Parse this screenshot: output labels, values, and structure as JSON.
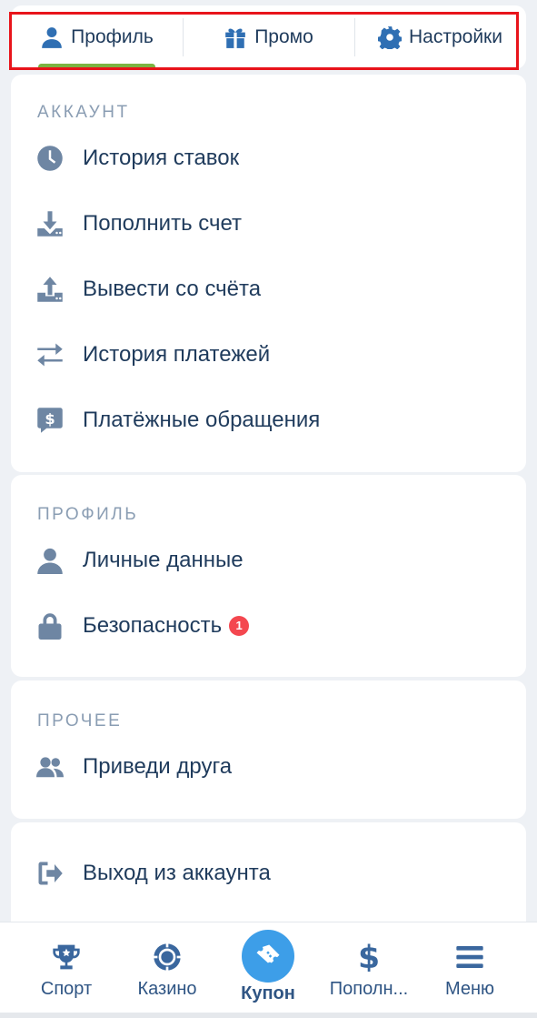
{
  "tabs": [
    {
      "label": "Профиль",
      "icon": "user-icon",
      "active": true
    },
    {
      "label": "Промо",
      "icon": "gift-icon",
      "active": false
    },
    {
      "label": "Настройки",
      "icon": "gear-icon",
      "active": false
    }
  ],
  "account": {
    "title": "АККАУНТ",
    "items": [
      {
        "label": "История ставок",
        "icon": "clock-icon"
      },
      {
        "label": "Пополнить счет",
        "icon": "download-icon"
      },
      {
        "label": "Вывести со счёта",
        "icon": "upload-icon"
      },
      {
        "label": "История платежей",
        "icon": "transfer-arrows-icon"
      },
      {
        "label": "Платёжные обращения",
        "icon": "dollar-chat-icon"
      }
    ]
  },
  "profile": {
    "title": "ПРОФИЛЬ",
    "items": [
      {
        "label": "Личные данные",
        "icon": "user-icon"
      },
      {
        "label": "Безопасность",
        "icon": "lock-icon",
        "badge": "1"
      }
    ]
  },
  "other": {
    "title": "ПРОЧЕЕ",
    "items": [
      {
        "label": "Приведи друга",
        "icon": "users-icon"
      }
    ]
  },
  "logout": {
    "label": "Выход из аккаунта",
    "icon": "logout-icon"
  },
  "bottom_nav": [
    {
      "label": "Спорт",
      "icon": "trophy-icon"
    },
    {
      "label": "Казино",
      "icon": "casino-chip-icon"
    },
    {
      "label": "Купон",
      "icon": "ticket-icon"
    },
    {
      "label": "Пополн...",
      "icon": "dollar-icon"
    },
    {
      "label": "Меню",
      "icon": "menu-icon"
    }
  ],
  "colors": {
    "accent_green": "#7cb342",
    "icon_blue": "#2f6fb3",
    "coupon_blue": "#3d9ee8",
    "badge_red": "#f4474f",
    "highlight_red": "#e8141b"
  }
}
